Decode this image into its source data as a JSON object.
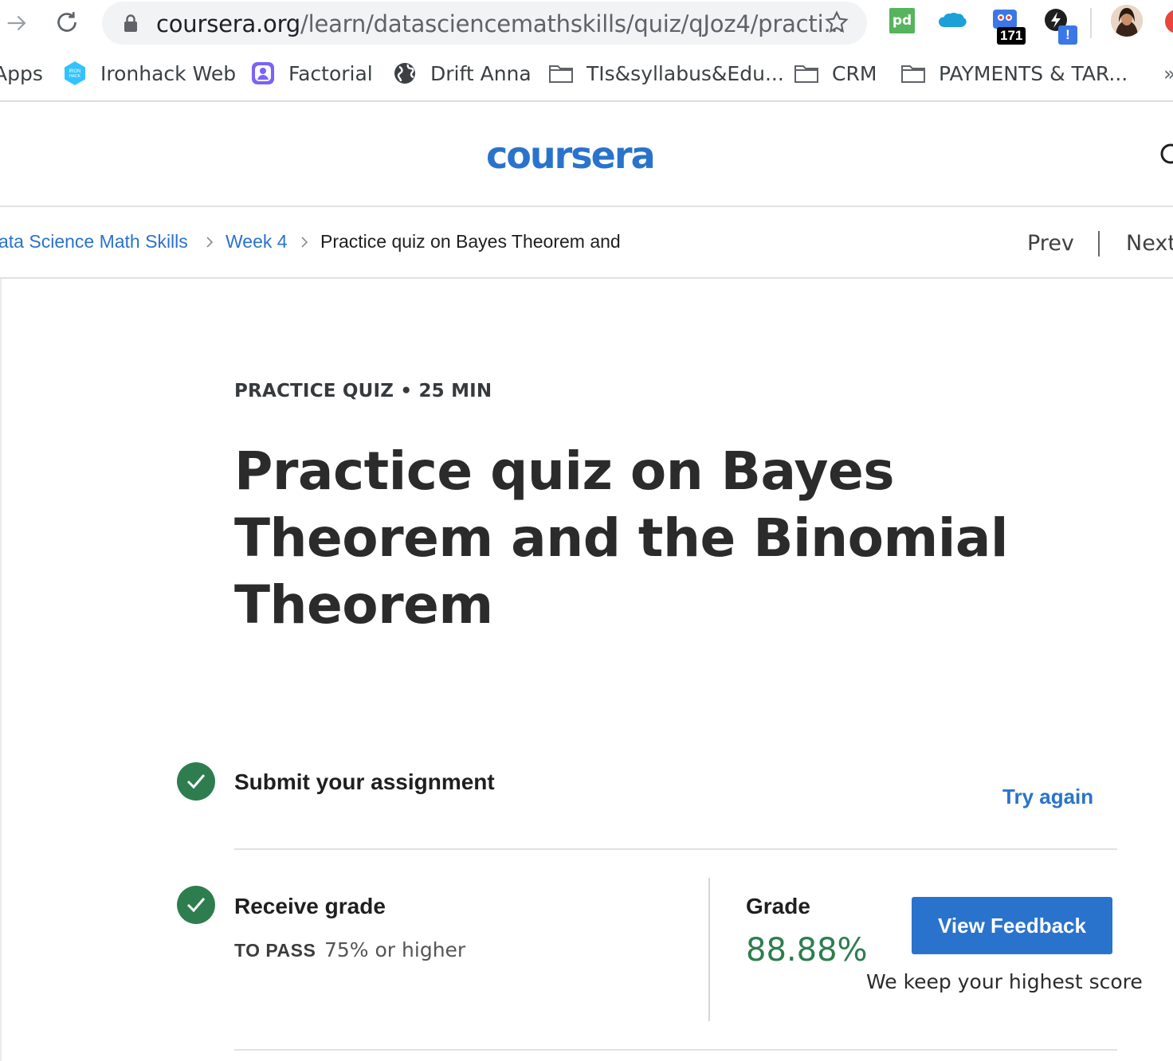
{
  "browser": {
    "url_host": "coursera.org",
    "url_path": "/learn/datasciencemathskills/quiz/qJoz4/practi...",
    "extensions": {
      "pd_label": "pd",
      "badge_count": "171",
      "alert_label": "!"
    },
    "bookmarks": [
      {
        "label": "Apps",
        "icon": "apps-icon"
      },
      {
        "label": "Ironhack Web",
        "icon": "ironhack-icon"
      },
      {
        "label": "Factorial",
        "icon": "factorial-icon"
      },
      {
        "label": "Drift Anna",
        "icon": "globe-icon"
      },
      {
        "label": "TIs&syllabus&Edu...",
        "icon": "folder-icon"
      },
      {
        "label": "CRM",
        "icon": "folder-icon"
      },
      {
        "label": "PAYMENTS & TAR...",
        "icon": "folder-icon"
      },
      {
        "label": "»",
        "icon": "more-icon"
      }
    ]
  },
  "site": {
    "logo_text": "coursera",
    "brand_color": "#2a73cc"
  },
  "breadcrumb": {
    "items": [
      {
        "label": "ata Science Math Skills"
      },
      {
        "label": "Week 4"
      },
      {
        "label": "Practice quiz on Bayes Theorem and"
      }
    ],
    "prev_label": "Prev",
    "next_label": "Next"
  },
  "quiz": {
    "eyebrow": "PRACTICE QUIZ • 25 MIN",
    "title": "Practice quiz on Bayes Theorem and the Binomial Theorem",
    "submit_step": {
      "title": "Submit your assignment",
      "action_label": "Try again"
    },
    "grade_step": {
      "title": "Receive grade",
      "to_pass_label": "TO PASS",
      "to_pass_value": "75% or higher",
      "grade_label": "Grade",
      "grade_value": "88.88%",
      "button_label": "View Feedback",
      "note": "We keep your highest score"
    },
    "success_color": "#2e7d4f"
  }
}
